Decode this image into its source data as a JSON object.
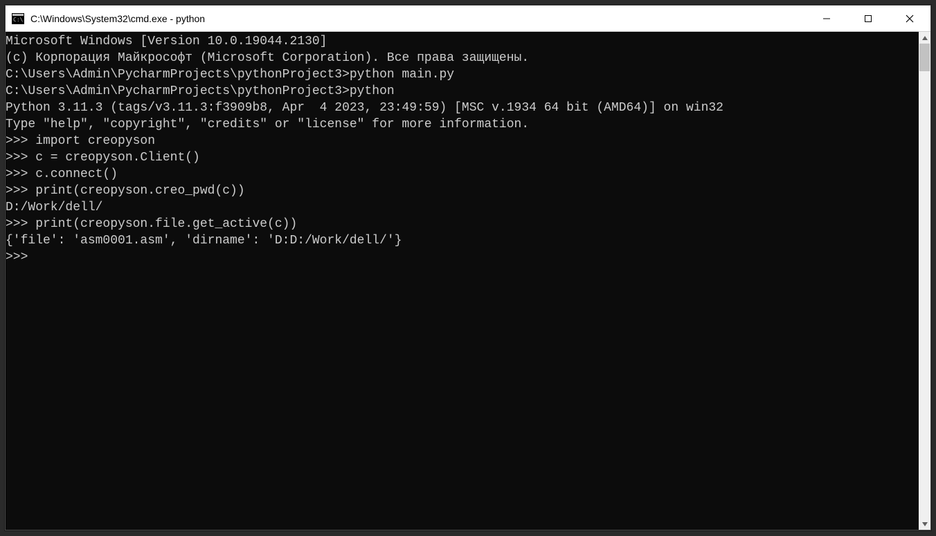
{
  "titlebar": {
    "title": "C:\\Windows\\System32\\cmd.exe - python"
  },
  "terminal": {
    "lines": [
      "Microsoft Windows [Version 10.0.19044.2130]",
      "(c) Корпорация Майкрософт (Microsoft Corporation). Все права защищены.",
      "",
      "C:\\Users\\Admin\\PycharmProjects\\pythonProject3>python main.py",
      "",
      "",
      "C:\\Users\\Admin\\PycharmProjects\\pythonProject3>python",
      "Python 3.11.3 (tags/v3.11.3:f3909b8, Apr  4 2023, 23:49:59) [MSC v.1934 64 bit (AMD64)] on win32",
      "Type \"help\", \"copyright\", \"credits\" or \"license\" for more information.",
      ">>> import creopyson",
      ">>> c = creopyson.Client()",
      ">>> c.connect()",
      ">>> print(creopyson.creo_pwd(c))",
      "D:/Work/dell/",
      ">>> print(creopyson.file.get_active(c))",
      "{'file': 'asm0001.asm', 'dirname': 'D:D:/Work/dell/'}",
      ">>>"
    ]
  }
}
